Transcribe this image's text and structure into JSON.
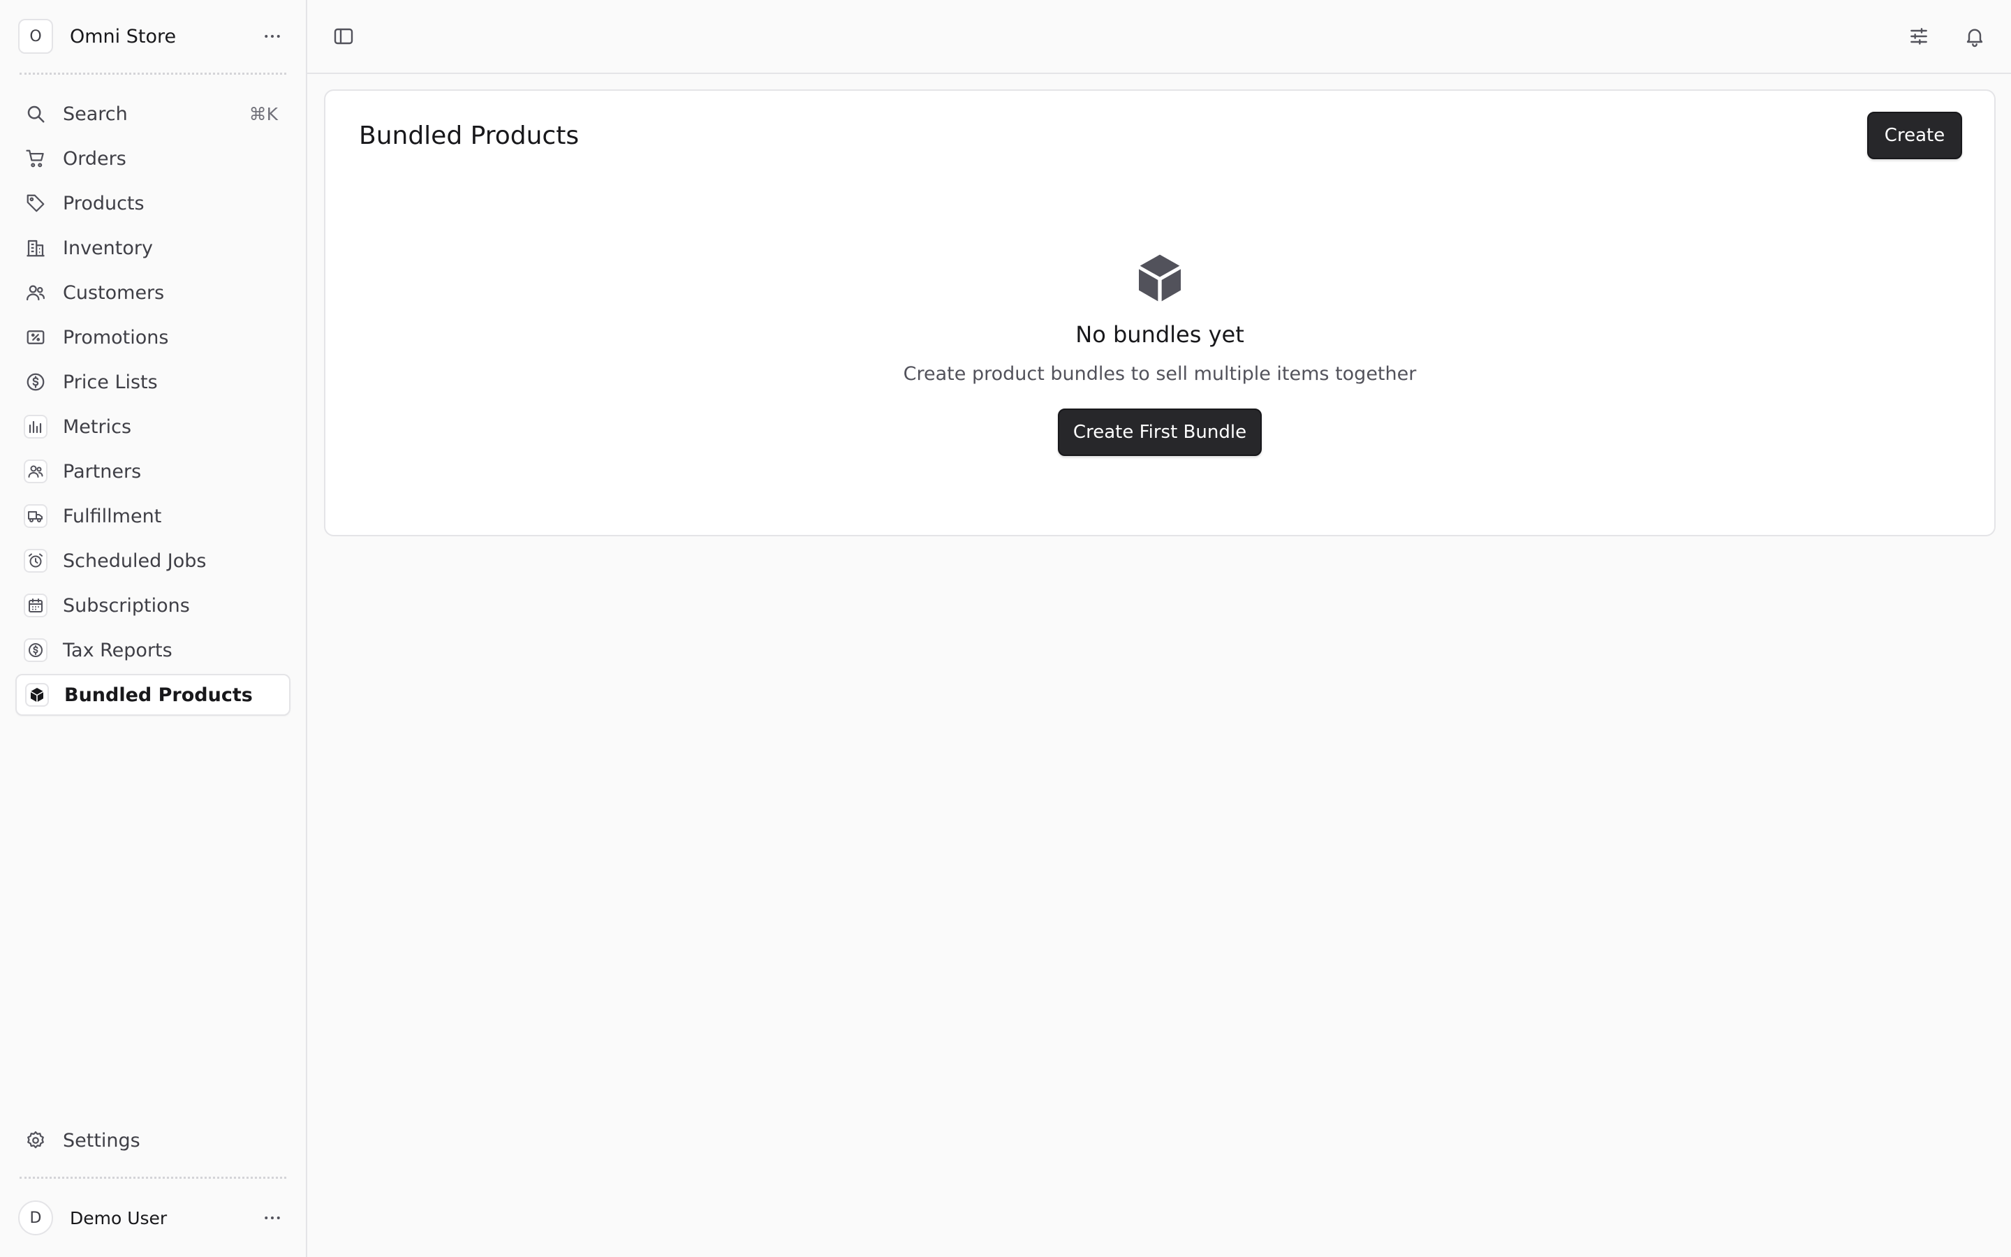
{
  "store": {
    "avatar_letter": "O",
    "name": "Omni Store"
  },
  "sidebar": {
    "items": [
      {
        "label": "Search",
        "shortcut": "⌘K",
        "icon": "search-icon"
      },
      {
        "label": "Orders",
        "icon": "cart-icon"
      },
      {
        "label": "Products",
        "icon": "tag-icon"
      },
      {
        "label": "Inventory",
        "icon": "building-icon"
      },
      {
        "label": "Customers",
        "icon": "users-icon"
      },
      {
        "label": "Promotions",
        "icon": "receipt-percent-icon"
      },
      {
        "label": "Price Lists",
        "icon": "currency-dollar-icon"
      },
      {
        "label": "Metrics",
        "icon": "bar-chart-icon"
      },
      {
        "label": "Partners",
        "icon": "users-icon"
      },
      {
        "label": "Fulfillment",
        "icon": "truck-icon"
      },
      {
        "label": "Scheduled Jobs",
        "icon": "alarm-clock-icon"
      },
      {
        "label": "Subscriptions",
        "icon": "calendar-icon"
      },
      {
        "label": "Tax Reports",
        "icon": "currency-dollar-icon"
      },
      {
        "label": "Bundled Products",
        "icon": "cube-icon",
        "active": true
      }
    ],
    "settings_label": "Settings"
  },
  "user": {
    "avatar_letter": "D",
    "name": "Demo User"
  },
  "main": {
    "title": "Bundled Products",
    "create_label": "Create",
    "empty": {
      "icon": "cube-icon",
      "title": "No bundles yet",
      "description": "Create product bundles to sell multiple items together",
      "button_label": "Create First Bundle"
    }
  },
  "topbar": {
    "icons": [
      "sidebar-toggle-icon",
      "adjustments-icon",
      "bell-icon"
    ]
  },
  "colors": {
    "background": "#fafafa",
    "surface": "#ffffff",
    "border": "#e4e4e7",
    "button_dark": "#27272a",
    "text_primary": "#18181b",
    "text_secondary": "#52525b"
  }
}
